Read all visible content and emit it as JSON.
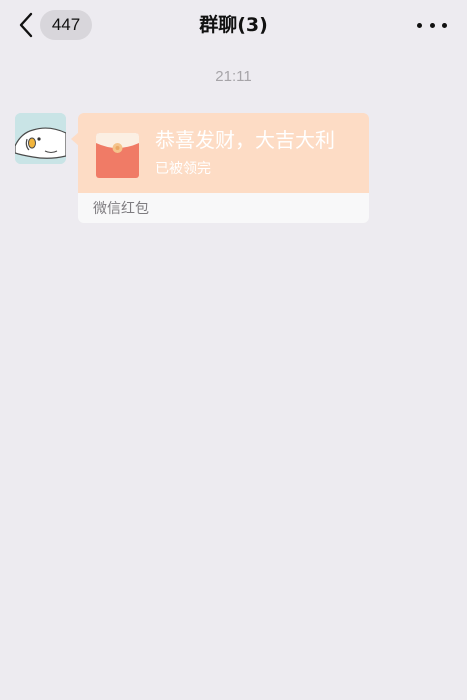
{
  "navbar": {
    "back_badge": "447",
    "title": "群聊(3)"
  },
  "messages": [
    {
      "timestamp": "21:11",
      "red_packet": {
        "wish": "恭喜发财，大吉大利",
        "status": "已被领完",
        "footer_label": "微信红包",
        "colors": {
          "top_background": "#FDDCC5",
          "envelope": "#F07B66"
        }
      }
    }
  ],
  "colors": {
    "page_background": "#EDEBF0",
    "badge_background": "#D8D6DB",
    "timestamp_text": "#A6A4A8"
  }
}
